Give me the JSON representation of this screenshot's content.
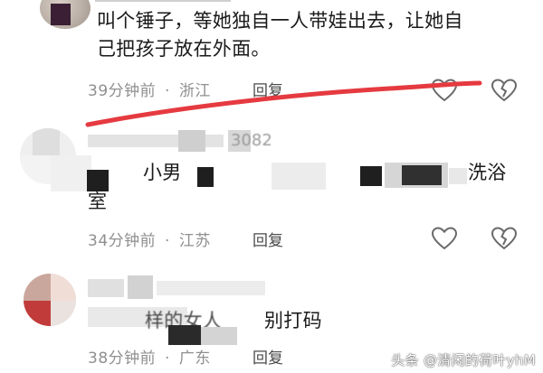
{
  "comments": [
    {
      "text_line1": "叫个锤子，等她独自一人带娃出去，让她自",
      "text_line2": "己把孩子放在外面。",
      "time": "39分钟前",
      "location": "浙江",
      "reply_label": "回复",
      "username_visible": "",
      "like_icon": "heart-outline-icon",
      "dislike_icon": "broken-heart-icon"
    },
    {
      "username_visible": "3082",
      "text_segment_a": "小男",
      "text_segment_b": "洗浴",
      "text_line2": "室",
      "time": "34分钟前",
      "location": "江苏",
      "reply_label": "回复",
      "like_icon": "heart-outline-icon",
      "dislike_icon": "broken-heart-icon"
    },
    {
      "text_segment_b": "样的女人",
      "text_segment_c": "别打码",
      "time": "38分钟前",
      "location": "广东",
      "reply_label": "回复",
      "like_icon": "heart-outline-icon",
      "dislike_icon": "broken-heart-icon"
    }
  ],
  "annotation": {
    "color": "#e53a40"
  },
  "watermark": {
    "text": "头条 @清闲的荷叶yhM"
  },
  "colors": {
    "meta": "#8f8f8f",
    "text": "#1a1a1a",
    "icon": "#6a6a6a"
  }
}
